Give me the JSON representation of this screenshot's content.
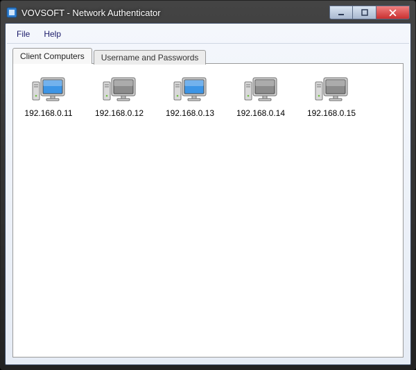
{
  "window": {
    "title": "VOVSOFT - Network Authenticator"
  },
  "menubar": {
    "file": "File",
    "help": "Help"
  },
  "tabs": {
    "client_computers": "Client Computers",
    "username_passwords": "Username and Passwords"
  },
  "computers": [
    {
      "ip": "192.168.0.11",
      "status": "online"
    },
    {
      "ip": "192.168.0.12",
      "status": "offline"
    },
    {
      "ip": "192.168.0.13",
      "status": "online"
    },
    {
      "ip": "192.168.0.14",
      "status": "offline"
    },
    {
      "ip": "192.168.0.15",
      "status": "offline"
    }
  ],
  "colors": {
    "online": "#3d95e6",
    "offline": "#8c8c8c"
  }
}
